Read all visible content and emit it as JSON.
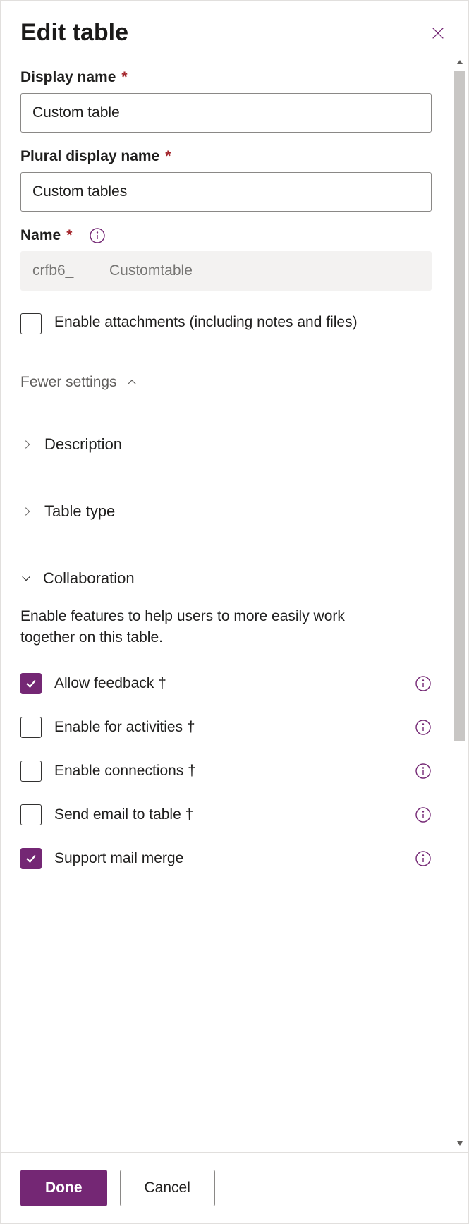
{
  "header": {
    "title": "Edit table"
  },
  "fields": {
    "display_name": {
      "label": "Display name",
      "value": "Custom table",
      "required": true
    },
    "plural_name": {
      "label": "Plural display name",
      "value": "Custom tables",
      "required": true
    },
    "name": {
      "label": "Name",
      "prefix": "crfb6_",
      "value": "Customtable",
      "required": true
    }
  },
  "attachments": {
    "label": "Enable attachments (including notes and files)",
    "checked": false
  },
  "settings_toggle": "Fewer settings",
  "accordion": {
    "description": "Description",
    "table_type": "Table type"
  },
  "collaboration": {
    "title": "Collaboration",
    "desc": "Enable features to help users to more easily work together on this table.",
    "items": [
      {
        "label": "Allow feedback †",
        "checked": true
      },
      {
        "label": "Enable for activities †",
        "checked": false
      },
      {
        "label": "Enable connections †",
        "checked": false
      },
      {
        "label": "Send email to table †",
        "checked": false
      },
      {
        "label": "Support mail merge",
        "checked": true
      }
    ]
  },
  "footer": {
    "done": "Done",
    "cancel": "Cancel"
  }
}
